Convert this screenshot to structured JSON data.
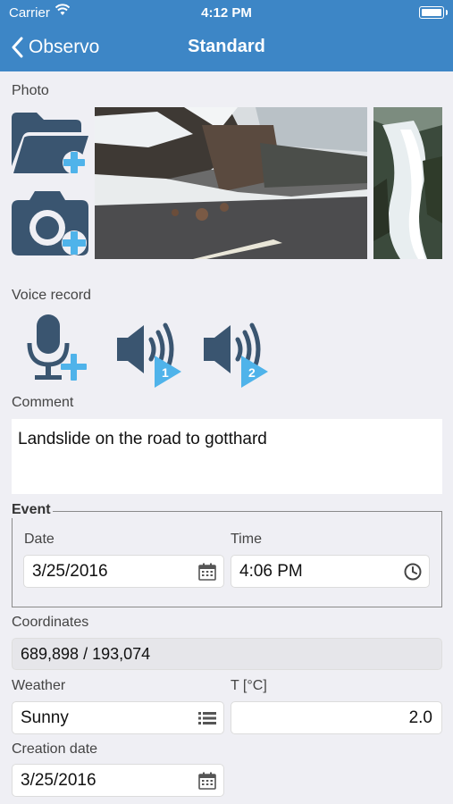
{
  "status_bar": {
    "carrier": "Carrier",
    "time": "4:12 PM"
  },
  "nav": {
    "back_label": "Observo",
    "title": "Standard"
  },
  "photo": {
    "label": "Photo",
    "buttons": [
      "add-from-folder",
      "take-photo"
    ],
    "thumbnails": [
      "landslide road photo",
      "waterfall photo"
    ]
  },
  "voice": {
    "label": "Voice record",
    "recordings": [
      "1",
      "2"
    ]
  },
  "comment": {
    "label": "Comment",
    "value": "Landslide on the road to gotthard"
  },
  "event": {
    "legend": "Event",
    "date_label": "Date",
    "date_value": "3/25/2016",
    "time_label": "Time",
    "time_value": "4:06 PM"
  },
  "coordinates": {
    "label": "Coordinates",
    "value": "689,898 / 193,074"
  },
  "weather": {
    "label": "Weather",
    "value": "Sunny"
  },
  "temperature": {
    "label": "T [°C]",
    "value": "2.0"
  },
  "creation_date": {
    "label": "Creation date",
    "value": "3/25/2016"
  },
  "colors": {
    "accent": "#3d86c6",
    "icon_dark": "#3a5570",
    "icon_plus": "#4fb3ea",
    "background": "#efeff4"
  }
}
